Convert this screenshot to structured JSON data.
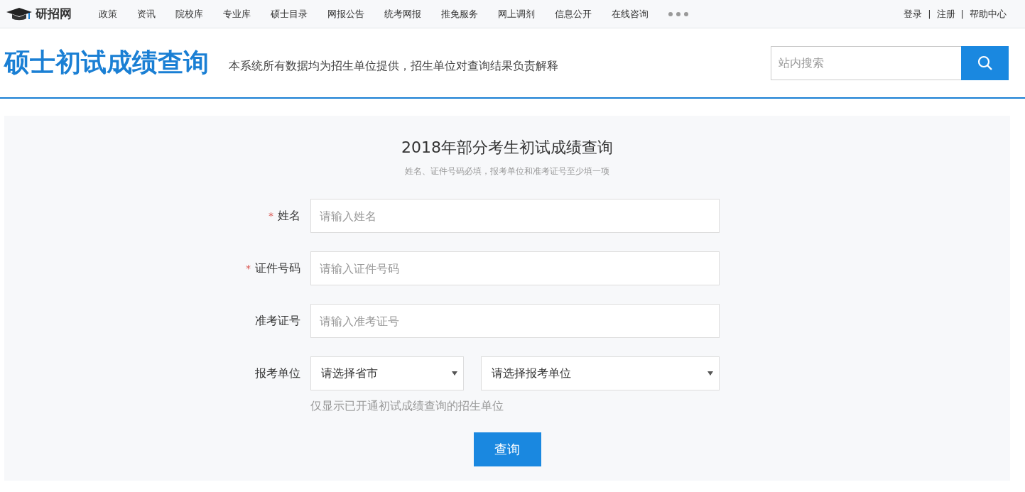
{
  "top_bar": {
    "logo": "研招网",
    "nav": [
      "政策",
      "资讯",
      "院校库",
      "专业库",
      "硕士目录",
      "网报公告",
      "统考网报",
      "推免服务",
      "网上调剂",
      "信息公开",
      "在线咨询"
    ],
    "account_links": [
      "登录",
      "注册",
      "帮助中心"
    ],
    "separator": "|"
  },
  "header": {
    "title": "硕士初试成绩查询",
    "subtitle": "本系统所有数据均为招生单位提供，招生单位对查询结果负责解释",
    "search": {
      "placeholder": "站内搜索"
    }
  },
  "form": {
    "title": "2018年部分考生初试成绩查询",
    "note": "姓名、证件号码必填，报考单位和准考证号至少填一项",
    "fields": [
      {
        "kind": "text",
        "label": "姓名",
        "required_mark": "*",
        "placeholder": "请输入姓名"
      },
      {
        "kind": "text",
        "label": "证件号码",
        "required_mark": "*",
        "placeholder": "请输入证件号码"
      },
      {
        "kind": "text",
        "label": "准考证号",
        "placeholder": "请输入准考证号"
      },
      {
        "kind": "select",
        "label": "报考单位",
        "selects": [
          "请选择省市",
          "请选择报考单位"
        ],
        "hint": "仅显示已开通初试成绩查询的招生单位"
      }
    ],
    "submit": "查询"
  }
}
